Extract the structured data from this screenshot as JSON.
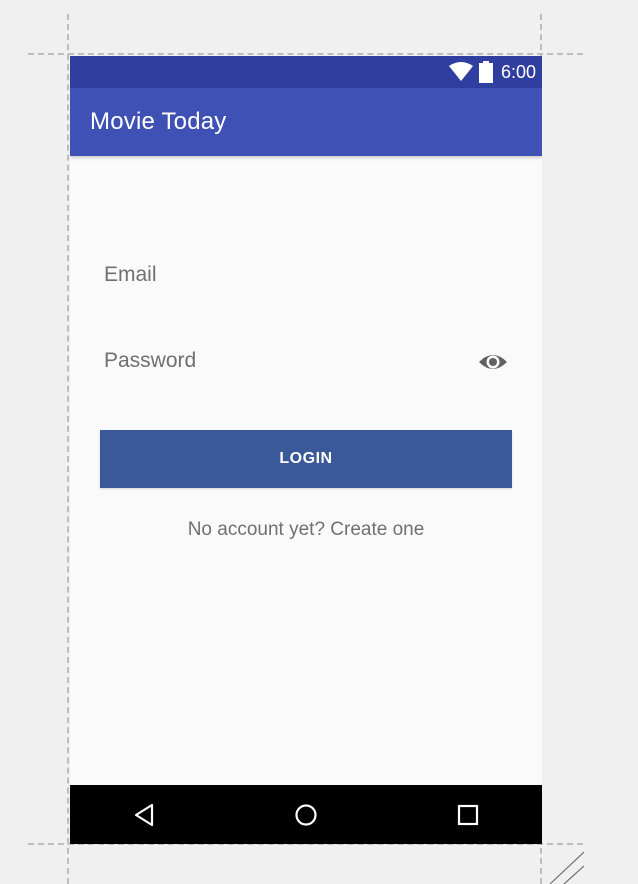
{
  "status_bar": {
    "time": "6:00",
    "icons": [
      "wifi-icon",
      "battery-icon"
    ]
  },
  "app_bar": {
    "title": "Movie Today"
  },
  "login_form": {
    "email_placeholder": "Email",
    "password_placeholder": "Password",
    "password_toggle_icon": "eye-icon",
    "login_label": "LOGIN",
    "signup_prompt": "No account yet? Create one"
  },
  "nav_bar": {
    "buttons": [
      "back-icon",
      "home-icon",
      "recents-icon"
    ]
  },
  "colors": {
    "status_bar": "#303f9f",
    "app_bar": "#3f51b5",
    "login_button": "#3b5998",
    "screen_background": "#fafafa",
    "nav_bar": "#000000",
    "hint_text": "#707070"
  }
}
